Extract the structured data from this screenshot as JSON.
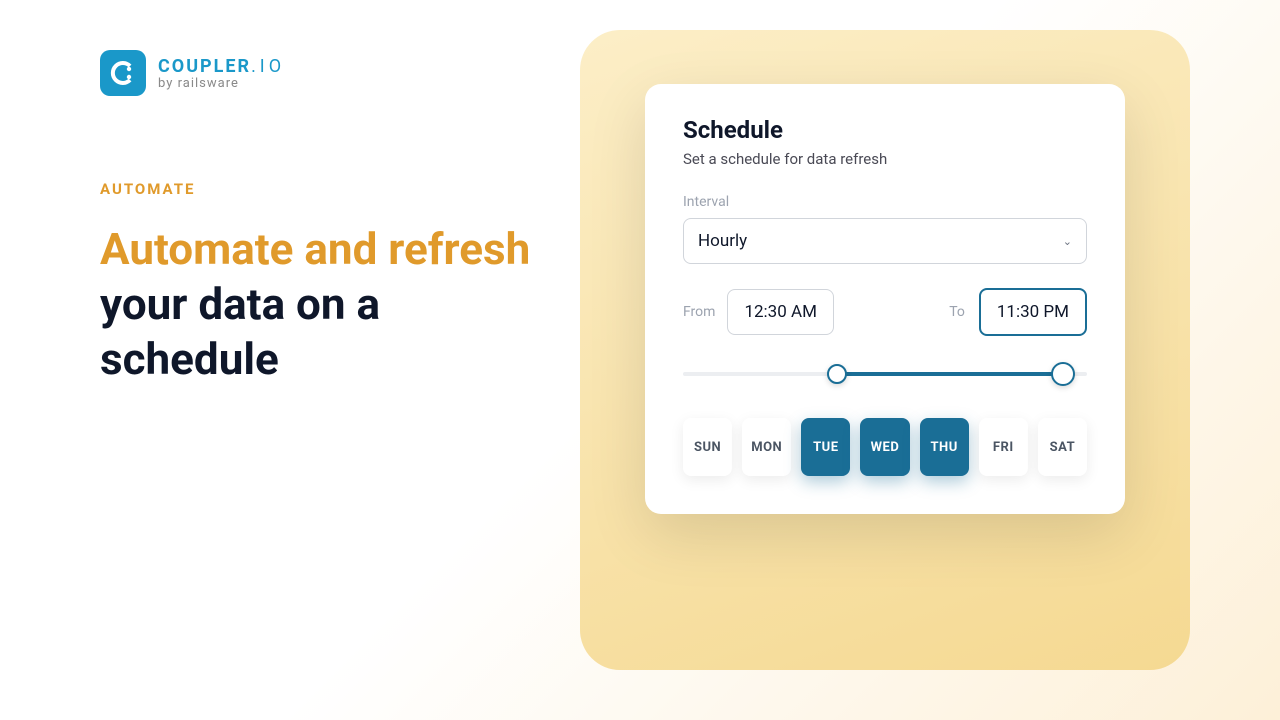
{
  "brand": {
    "name": "COUPLER",
    "suffix": ".IO",
    "byline": "by railsware"
  },
  "hero": {
    "eyebrow": "AUTOMATE",
    "headline_accent": "Automate and refresh",
    "headline_rest": " your data on a schedule"
  },
  "card": {
    "title": "Schedule",
    "subtitle": "Set a schedule for data refresh",
    "interval_label": "Interval",
    "interval_value": "Hourly",
    "from_label": "From",
    "from_value": "12:30 AM",
    "to_label": "To",
    "to_value": "11:30 PM",
    "days": [
      {
        "label": "SUN",
        "selected": false
      },
      {
        "label": "MON",
        "selected": false
      },
      {
        "label": "TUE",
        "selected": true
      },
      {
        "label": "WED",
        "selected": true
      },
      {
        "label": "THU",
        "selected": true
      },
      {
        "label": "FRI",
        "selected": false
      },
      {
        "label": "SAT",
        "selected": false
      }
    ]
  },
  "colors": {
    "accent_orange": "#e09a2b",
    "brand_blue": "#1a98c9",
    "primary_teal": "#1a6e96"
  }
}
